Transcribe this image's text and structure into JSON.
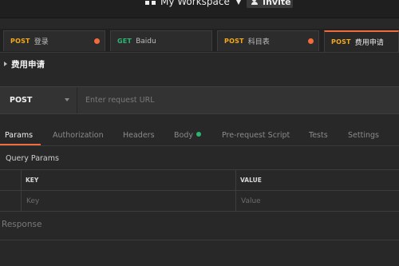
{
  "header": {
    "workspace_title": "My Workspace",
    "workspace_icon": "workspace-grid-icon",
    "invite_label": "Invite",
    "invite_icon": "add-user-icon"
  },
  "tabs": [
    {
      "method": "POST",
      "method_color": "#f2a91d",
      "name": "登录",
      "unsaved": true,
      "active": false
    },
    {
      "method": "GET",
      "method_color": "#2bb673",
      "name": "Baidu",
      "unsaved": false,
      "active": false
    },
    {
      "method": "POST",
      "method_color": "#f2a91d",
      "name": "科目表",
      "unsaved": true,
      "active": false
    },
    {
      "method": "POST",
      "method_color": "#f2a91d",
      "name": "费用申请",
      "unsaved": false,
      "active": true
    }
  ],
  "request": {
    "title": "费用申请",
    "method": "POST",
    "url_value": "",
    "url_placeholder": "Enter request URL"
  },
  "subtabs": {
    "params": "Params",
    "authorization": "Authorization",
    "headers": "Headers",
    "body": "Body",
    "prerequest": "Pre-request Script",
    "tests": "Tests",
    "settings": "Settings",
    "active": "Params",
    "body_indicator_color": "#2bb673"
  },
  "query_params": {
    "label": "Query Params",
    "columns": [
      "KEY",
      "VALUE"
    ],
    "row_key_placeholder": "Key",
    "row_value_placeholder": "Value"
  },
  "response": {
    "label": "Response"
  },
  "colors": {
    "accent": "#f26b3a",
    "post": "#f2a91d",
    "get": "#2bb673",
    "background": "#282828"
  }
}
